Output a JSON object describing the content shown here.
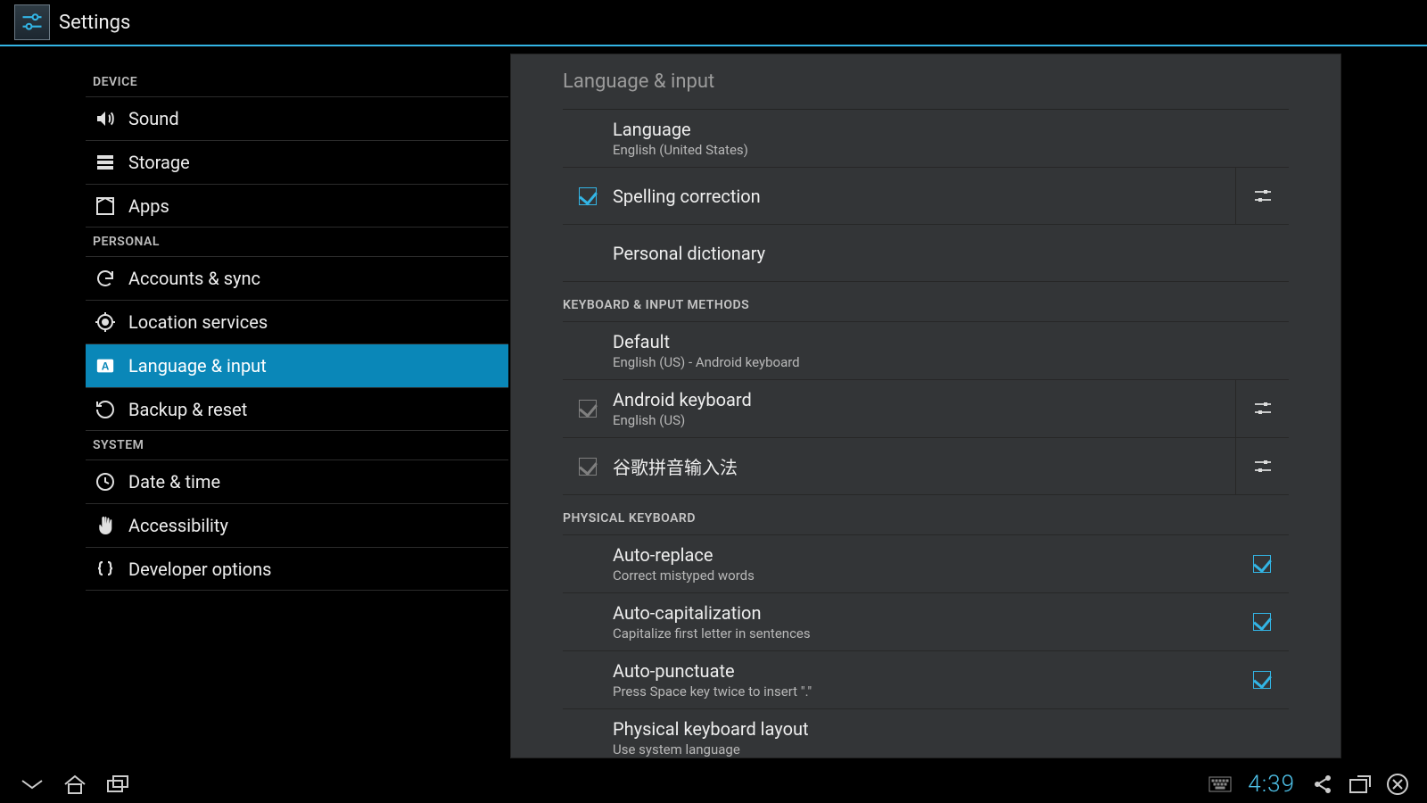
{
  "app": {
    "title": "Settings"
  },
  "sidebar": {
    "sections": [
      {
        "header": "DEVICE",
        "items": [
          {
            "id": "sound",
            "label": "Sound",
            "icon": "speaker-icon"
          },
          {
            "id": "storage",
            "label": "Storage",
            "icon": "storage-icon"
          },
          {
            "id": "apps",
            "label": "Apps",
            "icon": "apps-icon"
          }
        ]
      },
      {
        "header": "PERSONAL",
        "items": [
          {
            "id": "accounts",
            "label": "Accounts & sync",
            "icon": "sync-icon"
          },
          {
            "id": "location",
            "label": "Location services",
            "icon": "location-icon"
          },
          {
            "id": "language",
            "label": "Language & input",
            "icon": "keyboard-a-icon",
            "selected": true
          },
          {
            "id": "backup",
            "label": "Backup & reset",
            "icon": "restore-icon"
          }
        ]
      },
      {
        "header": "SYSTEM",
        "items": [
          {
            "id": "datetime",
            "label": "Date & time",
            "icon": "clock-icon"
          },
          {
            "id": "accessibility",
            "label": "Accessibility",
            "icon": "hand-icon"
          },
          {
            "id": "developer",
            "label": "Developer options",
            "icon": "braces-icon"
          }
        ]
      }
    ]
  },
  "panel": {
    "title": "Language & input",
    "general": {
      "language": {
        "title": "Language",
        "summary": "English (United States)"
      },
      "spelling": {
        "title": "Spelling correction",
        "checked": true,
        "has_settings": true
      },
      "dictionary": {
        "title": "Personal dictionary"
      }
    },
    "sections": {
      "keyboard_methods": {
        "header": "KEYBOARD & INPUT METHODS",
        "default": {
          "title": "Default",
          "summary": "English (US) - Android keyboard"
        },
        "imes": [
          {
            "id": "android_kbd",
            "title": "Android keyboard",
            "summary": "English (US)",
            "checked_dim": true,
            "has_settings": true
          },
          {
            "id": "google_pinyin",
            "title": "谷歌拼音输入法",
            "checked_dim": true,
            "has_settings": true
          }
        ]
      },
      "physical_keyboard": {
        "header": "PHYSICAL KEYBOARD",
        "items": [
          {
            "id": "auto_replace",
            "title": "Auto-replace",
            "summary": "Correct mistyped words",
            "checked": true
          },
          {
            "id": "auto_cap",
            "title": "Auto-capitalization",
            "summary": "Capitalize first letter in sentences",
            "checked": true
          },
          {
            "id": "auto_punct",
            "title": "Auto-punctuate",
            "summary": "Press Space key twice to insert \".\"",
            "checked": true
          },
          {
            "id": "layout",
            "title": "Physical keyboard layout",
            "summary": "Use system language"
          }
        ]
      }
    }
  },
  "statusbar": {
    "clock": "4:39"
  }
}
